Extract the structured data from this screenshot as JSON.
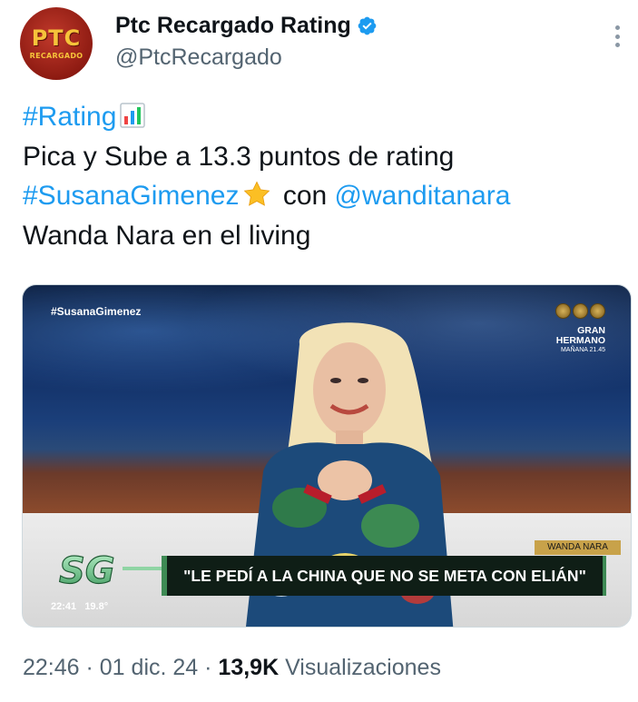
{
  "author": {
    "display_name": "Ptc Recargado Rating",
    "handle": "@PtcRecargado",
    "avatar_logo_main": "PTC",
    "avatar_logo_sub": "RECARGADO",
    "verified": true
  },
  "tweet": {
    "line1_hashtag": "#Rating",
    "line1_emoji": "bar-chart-emoji",
    "line2": "Pica y Sube a 13.3 puntos de rating",
    "line3_hashtag": "#SusanaGimenez",
    "line3_emoji": "star-emoji",
    "line3_text": " con ",
    "line3_mention": "@wanditanara",
    "line4": "Wanda Nara en el living"
  },
  "media": {
    "hashtag_overlay": "#SusanaGimenez",
    "gh_line1": "GRAN",
    "gh_line2": "HERMANO",
    "gh_line3": "MAÑANA 21.45",
    "logo_text": "SG",
    "lower_third_name": "WANDA NARA",
    "lower_third_quote": "\"LE PEDÍ A LA CHINA QUE NO SE META CON ELIÁN\"",
    "clock": "22:41",
    "temperature": "19.8°"
  },
  "meta": {
    "time": "22:46",
    "separator": " · ",
    "date": "01 dic. 24",
    "views_count": "13,9K",
    "views_label": " Visualizaciones"
  },
  "colors": {
    "link": "#1d9bf0",
    "secondary_text": "#536471",
    "primary_text": "#0f1419",
    "verified_badge": "#1d9bf0"
  }
}
